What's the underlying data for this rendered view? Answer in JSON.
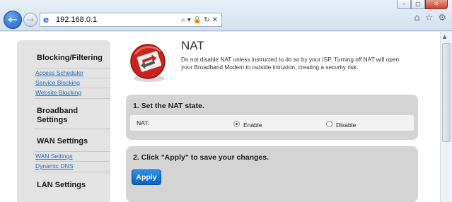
{
  "browser": {
    "url": "192.168.0.1",
    "window_controls": {
      "minimize": "–",
      "maximize": "□",
      "close": "✕"
    },
    "address_tools": [
      "⌕",
      "▾",
      "🔒",
      "↻",
      "✕"
    ]
  },
  "sidebar": {
    "sections": [
      {
        "title": "Blocking/Filtering",
        "links": [
          "Access Scheduler",
          "Service Blocking",
          "Website Blocking"
        ]
      },
      {
        "title_line1": "Broadband",
        "title_line2": "Settings"
      },
      {
        "title": "WAN Settings",
        "links": [
          "WAN Settings",
          "Dynamic DNS"
        ]
      },
      {
        "title": "LAN Settings"
      }
    ]
  },
  "main": {
    "title": "NAT",
    "description": "Do not disable NAT unless instructed to do so by your ISP. Turning off NAT will open your Broadband Modem to outside intrusion, creating a security risk.",
    "step1": {
      "title": "1. Set the NAT state.",
      "label": "NAT:",
      "options": [
        "Enable",
        "Disable"
      ],
      "selected": "Enable"
    },
    "step2": {
      "title": "2. Click \"Apply\" to save your changes.",
      "button": "Apply"
    }
  },
  "colors": {
    "accent": "#1f6fc5",
    "panel": "#d4d4d4",
    "button": "#0a5fc0"
  }
}
